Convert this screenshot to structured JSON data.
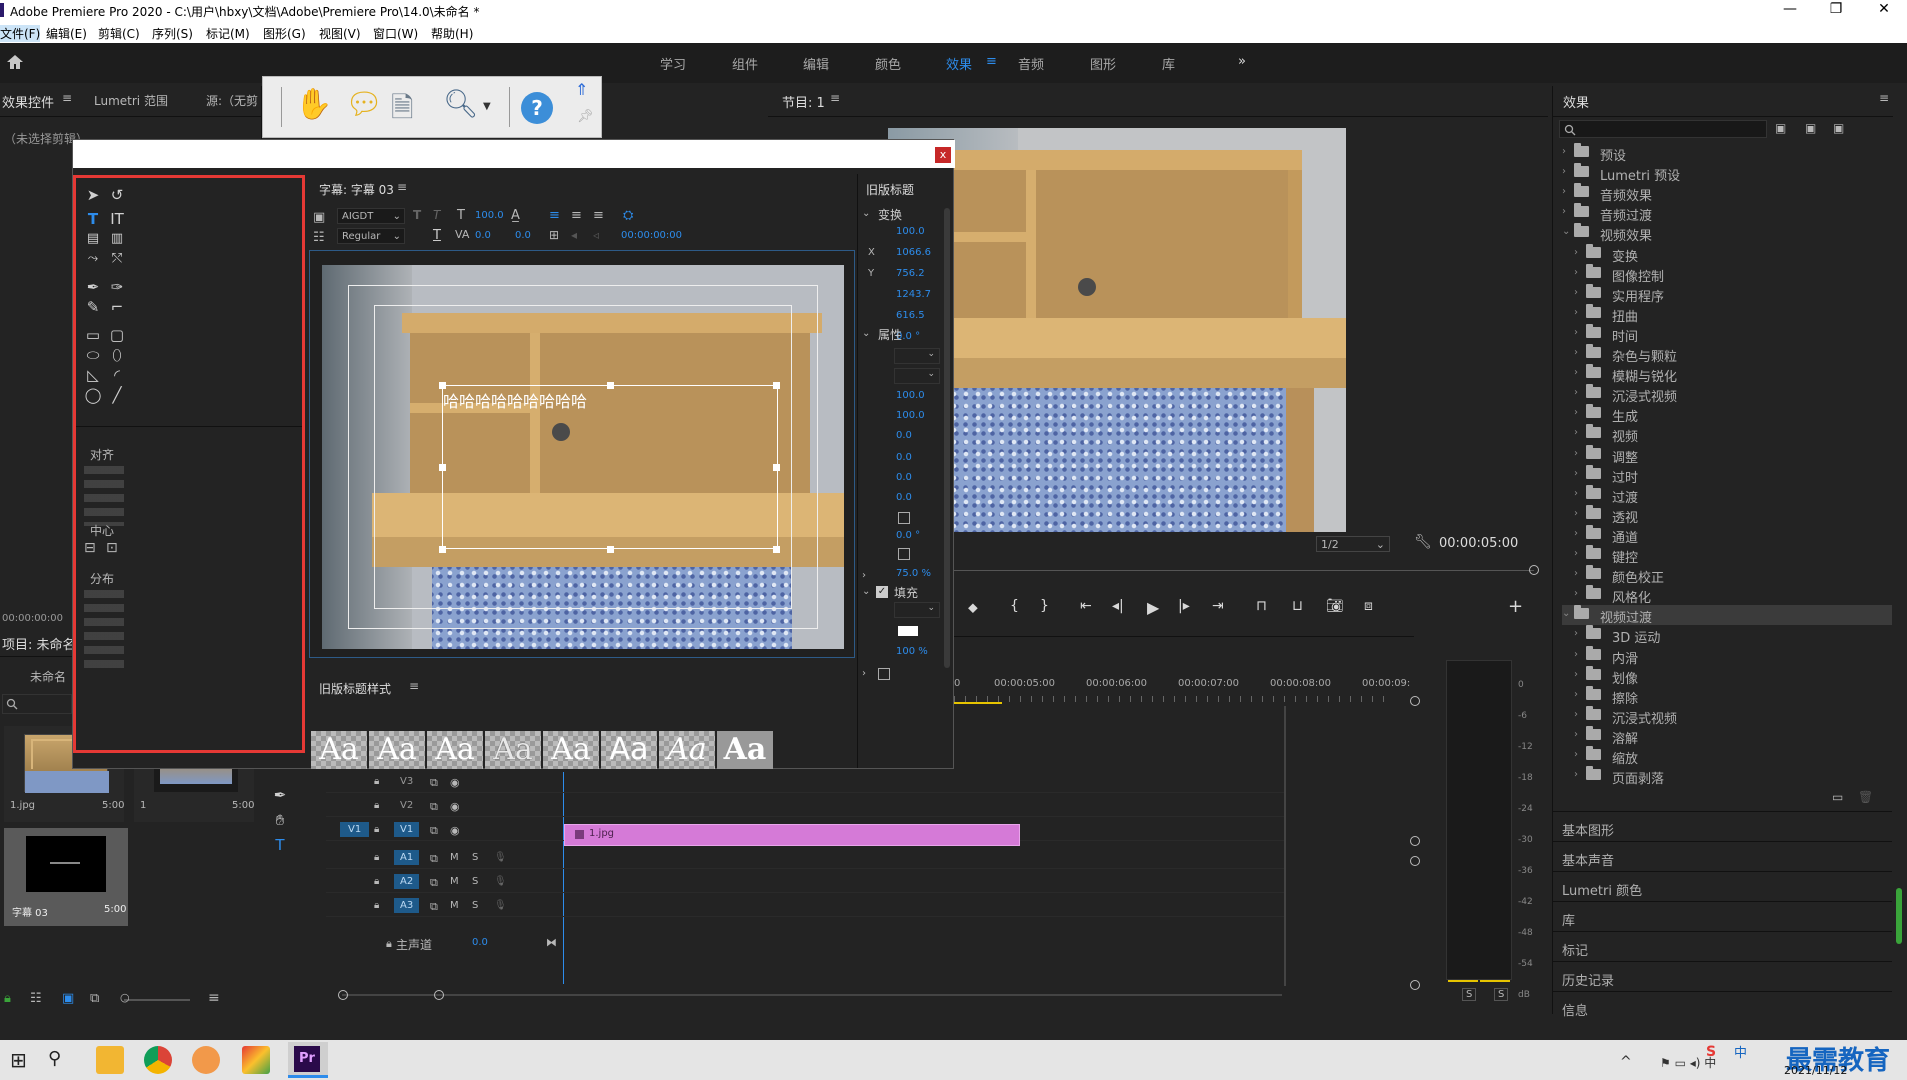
{
  "window": {
    "title": "Adobe Premiere Pro 2020 - C:\\用户\\hbxy\\文档\\Adobe\\Premiere Pro\\14.0\\未命名 *",
    "min": "—",
    "max": "❐",
    "close": "✕"
  },
  "menu": [
    "文件(F)",
    "编辑(E)",
    "剪辑(C)",
    "序列(S)",
    "标记(M)",
    "图形(G)",
    "视图(V)",
    "窗口(W)",
    "帮助(H)"
  ],
  "workspaces": [
    "学习",
    "组件",
    "编辑",
    "颜色",
    "效果",
    "音频",
    "图形",
    "库"
  ],
  "workspace_more": "»",
  "left_panel": {
    "tabs": [
      "效果控件",
      "Lumetri 范围",
      "源:（无剪"
    ],
    "no_clip": "（未选择剪辑）",
    "timecode": "00:00:00:00"
  },
  "project": {
    "title": "项目: 未命名",
    "name": "未命名",
    "items": [
      {
        "name": "1.jpg",
        "dur": "5:00"
      },
      {
        "name": "1",
        "dur": "5:00"
      },
      {
        "name": "字幕 03",
        "dur": "5:00"
      }
    ]
  },
  "program": {
    "title": "节目: 1",
    "zoom": "1/2",
    "timecode": "00:00:05:00"
  },
  "title_dialog": {
    "close": "x",
    "subtitle_tab": "字幕: 字幕 03",
    "font": "AIGDT",
    "style": "Regular",
    "font_size": "100.0",
    "kerning": "0.0",
    "leading": "0.0",
    "tab_time": "00:00:00:00",
    "canvas_text": "哈哈哈哈哈哈哈哈哈",
    "align_label": "对齐",
    "center_label": "中心",
    "distribute_label": "分布",
    "styles_title": "旧版标题样式",
    "style_samples": [
      "Aa",
      "Aa",
      "Aa",
      "Aa",
      "Aa",
      "Aa",
      "Aa",
      "Aa"
    ],
    "props_title": "旧版标题",
    "transform": "变换",
    "props": "属性",
    "fill": "填充",
    "transform_values": [
      "100.0",
      "1066.6",
      "756.2",
      "1243.7",
      "616.5",
      "0.0 °"
    ],
    "transform_keys": [
      "",
      "X",
      "Y",
      "",
      "",
      ""
    ],
    "prop_values": [
      "100.0",
      "100.0",
      "0.0",
      "0.0",
      "0.0",
      "0.0",
      "0.0 °",
      "75.0 %"
    ],
    "fill_value": "100 %"
  },
  "effects": {
    "title": "效果",
    "items": [
      {
        "l": 0,
        "t": "预设"
      },
      {
        "l": 0,
        "t": "Lumetri 预设"
      },
      {
        "l": 0,
        "t": "音频效果"
      },
      {
        "l": 0,
        "t": "音频过渡"
      },
      {
        "l": 0,
        "t": "视频效果",
        "open": true
      },
      {
        "l": 1,
        "t": "变换"
      },
      {
        "l": 1,
        "t": "图像控制"
      },
      {
        "l": 1,
        "t": "实用程序"
      },
      {
        "l": 1,
        "t": "扭曲"
      },
      {
        "l": 1,
        "t": "时间"
      },
      {
        "l": 1,
        "t": "杂色与颗粒"
      },
      {
        "l": 1,
        "t": "模糊与锐化"
      },
      {
        "l": 1,
        "t": "沉浸式视频"
      },
      {
        "l": 1,
        "t": "生成"
      },
      {
        "l": 1,
        "t": "视频"
      },
      {
        "l": 1,
        "t": "调整"
      },
      {
        "l": 1,
        "t": "过时"
      },
      {
        "l": 1,
        "t": "过渡"
      },
      {
        "l": 1,
        "t": "透视"
      },
      {
        "l": 1,
        "t": "通道"
      },
      {
        "l": 1,
        "t": "键控"
      },
      {
        "l": 1,
        "t": "颜色校正"
      },
      {
        "l": 1,
        "t": "风格化"
      },
      {
        "l": 0,
        "t": "视频过渡",
        "open": true,
        "sel": true
      },
      {
        "l": 1,
        "t": "3D 运动"
      },
      {
        "l": 1,
        "t": "内滑"
      },
      {
        "l": 1,
        "t": "划像"
      },
      {
        "l": 1,
        "t": "擦除"
      },
      {
        "l": 1,
        "t": "沉浸式视频"
      },
      {
        "l": 1,
        "t": "溶解"
      },
      {
        "l": 1,
        "t": "缩放"
      },
      {
        "l": 1,
        "t": "页面剥落"
      }
    ],
    "stacked": [
      "基本图形",
      "基本声音",
      "Lumetri 颜色",
      "库",
      "标记",
      "历史记录",
      "信息"
    ]
  },
  "timeline": {
    "ruler": [
      "0",
      "00:00:05:00",
      "00:00:06:00",
      "00:00:07:00",
      "00:00:08:00",
      "00:00:09:"
    ],
    "tracks": [
      {
        "id": "V3",
        "type": "v"
      },
      {
        "id": "V2",
        "type": "v"
      },
      {
        "id": "V1",
        "type": "v",
        "src": "V1"
      },
      {
        "id": "A1",
        "type": "a"
      },
      {
        "id": "A2",
        "type": "a"
      },
      {
        "id": "A3",
        "type": "a"
      }
    ],
    "master": "主声道",
    "master_val": "0.0",
    "clip": "1.jpg"
  },
  "meter": {
    "scale": [
      "0",
      "-6",
      "-12",
      "-18",
      "-24",
      "-30",
      "-36",
      "-42",
      "-48",
      "-54",
      "dB"
    ],
    "solo": [
      "S",
      "S"
    ]
  },
  "taskbar": {
    "ime": "中",
    "date": "2021/11/12",
    "watermark": "最需教育"
  },
  "colors": {
    "accent": "#2d8ceb",
    "clip": "#d57ad7",
    "highlight": "#e53935"
  }
}
